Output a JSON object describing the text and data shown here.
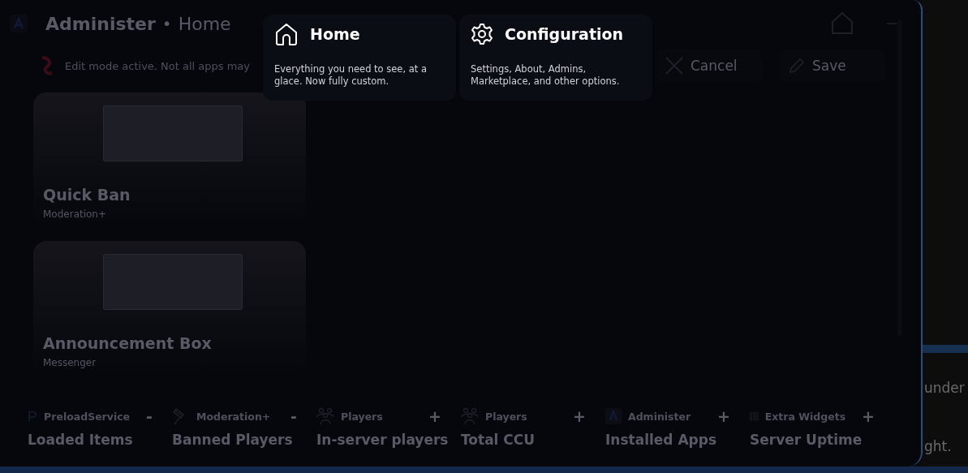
{
  "header": {
    "title": "Administer",
    "separator": "•",
    "page": "Home"
  },
  "notice": "Edit mode active. Not all apps may",
  "actions": [
    {
      "label": "Cancel",
      "kind": "cancel"
    },
    {
      "label": "Save",
      "kind": "save"
    }
  ],
  "apps": [
    {
      "name": "Quick Ban",
      "source": "Moderation+"
    },
    {
      "name": "Announcement Box",
      "source": "Messenger"
    }
  ],
  "stats": [
    {
      "source": "PreloadService",
      "action": "-",
      "label": "Loaded Items"
    },
    {
      "source": "Moderation+",
      "action": "-",
      "label": "Banned Players"
    },
    {
      "source": "Players",
      "action": "+",
      "label": "In-server players"
    },
    {
      "source": "Players",
      "action": "+",
      "label": "Total CCU"
    },
    {
      "source": "Administer",
      "action": "+",
      "label": "Installed Apps"
    },
    {
      "source": "Extra Widgets",
      "action": "+",
      "label": "Server Uptime"
    }
  ],
  "menu": [
    {
      "title": "Home",
      "description": "Everything you need to see, at a glace. Now fully custom."
    },
    {
      "title": "Configuration",
      "description": "Settings, About, Admins, Marketplace, and other options."
    }
  ],
  "background_text": [
    "under",
    "ght."
  ]
}
